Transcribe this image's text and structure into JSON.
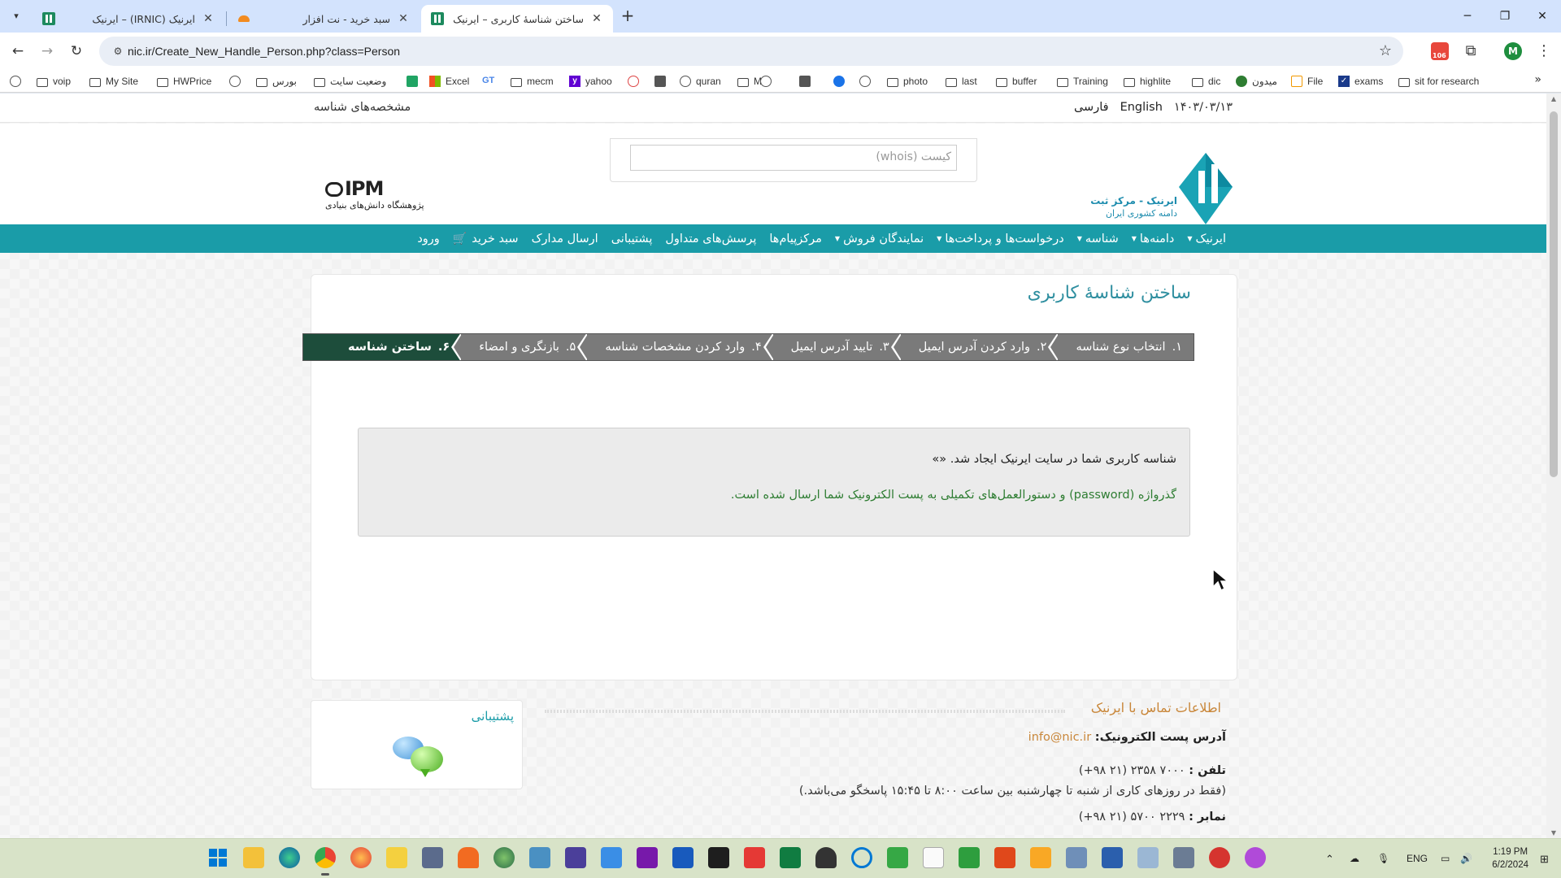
{
  "browser": {
    "tabs": [
      {
        "title": "ایرنیک (IRNIC) – ایرنیک",
        "active": false
      },
      {
        "title": "سبد خرید - نت افزار",
        "active": false
      },
      {
        "title": "ساختن شناسهٔ کاربری – ایرنیک",
        "active": true
      }
    ],
    "url": "nic.ir/Create_New_Handle_Person.php?class=Person",
    "extension_badge": "106",
    "profile_initial": "M",
    "bookmarks": [
      {
        "label": "",
        "icon": "globe-icon"
      },
      {
        "label": "voip",
        "icon": "folder-icon"
      },
      {
        "label": "My Site",
        "icon": "folder-icon"
      },
      {
        "label": "HWPrice",
        "icon": "folder-icon"
      },
      {
        "label": "",
        "icon": "globe-icon"
      },
      {
        "label": "بورس",
        "icon": "folder-icon"
      },
      {
        "label": "وضعیت سایت",
        "icon": "folder-icon"
      },
      {
        "label": "",
        "icon": "sheets-icon"
      },
      {
        "label": "Excel",
        "icon": "ms-icon"
      },
      {
        "label": "",
        "icon": "translate-icon"
      },
      {
        "label": "mecm",
        "icon": "folder-icon"
      },
      {
        "label": "yahoo",
        "icon": "yahoo-icon"
      },
      {
        "label": "",
        "icon": "red-icon"
      },
      {
        "label": "",
        "icon": "dark-icon"
      },
      {
        "label": "quran",
        "icon": "globe-icon"
      },
      {
        "label": "M",
        "icon": "folder-icon"
      },
      {
        "label": "",
        "icon": "globe-icon"
      },
      {
        "label": "",
        "icon": "dark-icon"
      },
      {
        "label": "",
        "icon": "blue-icon"
      },
      {
        "label": "",
        "icon": "globe-icon"
      },
      {
        "label": "photo",
        "icon": "folder-icon"
      },
      {
        "label": "last",
        "icon": "folder-icon"
      },
      {
        "label": "buffer",
        "icon": "folder-icon"
      },
      {
        "label": "Training",
        "icon": "folder-icon"
      },
      {
        "label": "highlite",
        "icon": "folder-icon"
      },
      {
        "label": "dic",
        "icon": "folder-icon"
      },
      {
        "label": "میدون",
        "icon": "dgreen-icon"
      },
      {
        "label": "File",
        "icon": "edit-icon"
      },
      {
        "label": "exams",
        "icon": "check-icon"
      },
      {
        "label": "sit for research",
        "icon": "folder-icon"
      }
    ]
  },
  "page": {
    "topbar": {
      "left_title": "مشخصه‌های شناسه",
      "date": "۱۴۰۳/۰۳/۱۳",
      "english": "English",
      "farsi": "فارسی"
    },
    "search": {
      "placeholder": "کیست (whois)"
    },
    "ipm": {
      "mark": "IPM",
      "sub": "پژوهشگاه دانش‌های بنیادی"
    },
    "nic_logo": {
      "line1": "ایرنیک - مرکز ثبت",
      "line2": "دامنه کشوری ایران"
    },
    "nav": [
      {
        "label": "ایرنیک",
        "caret": true
      },
      {
        "label": "دامنه‌ها",
        "caret": true
      },
      {
        "label": "شناسه",
        "caret": true
      },
      {
        "label": "درخواست‌ها و پرداخت‌ها",
        "caret": true
      },
      {
        "label": "نمایندگان فروش",
        "caret": true
      },
      {
        "label": "مرکزپیام‌ها",
        "caret": false
      },
      {
        "label": "پرسش‌های متداول",
        "caret": false
      },
      {
        "label": "پشتیبانی",
        "caret": false
      },
      {
        "label": "ارسال مدارک",
        "caret": false
      },
      {
        "label": "سبد خرید",
        "caret": false,
        "cart": true
      },
      {
        "label": "ورود",
        "caret": false
      }
    ],
    "title": "ساختن شناسهٔ کاربری",
    "steps": [
      {
        "num": "۱.",
        "label": "انتخاب نوع شناسه"
      },
      {
        "num": "۲.",
        "label": "وارد کردن آدرس ایمیل"
      },
      {
        "num": "۳.",
        "label": "تایید آدرس ایمیل"
      },
      {
        "num": "۴.",
        "label": "وارد کردن مشخصات شناسه"
      },
      {
        "num": "۵.",
        "label": "بازنگری و امضاء"
      },
      {
        "num": "۶.",
        "label": "ساختن شناسه"
      }
    ],
    "message": {
      "line1": "شناسه کاربری شما در سایت ایرنیک ایجاد شد. «»",
      "line2": "گذرواژه (password) و دستورالعمل‌های تکمیلی به پست الکترونیک شما ارسال شده است."
    },
    "support_title": "پشتیبانی",
    "contact": {
      "title": "اطلاعات تماس با ایرنیک",
      "email_label": "آدرس پست الکترونیک:",
      "email": "info@nic.ir",
      "phone_label": "تلفن :",
      "phone": "۷۰۰۰ ۲۳۵۸ (۲۱ ۹۸+)",
      "hours": "(فقط در روزهای کاری از شنبه تا چهارشنبه بین ساعت ۸:۰۰ تا ۱۵:۴۵ پاسخگو می‌باشد.)",
      "fax_label": "نمابر :",
      "fax": "۲۲۲۹ ۵۷۰۰ (۲۱ ۹۸+)"
    }
  },
  "taskbar": {
    "lang": "ENG",
    "time": "1:19 PM",
    "date": "6/2/2024"
  }
}
